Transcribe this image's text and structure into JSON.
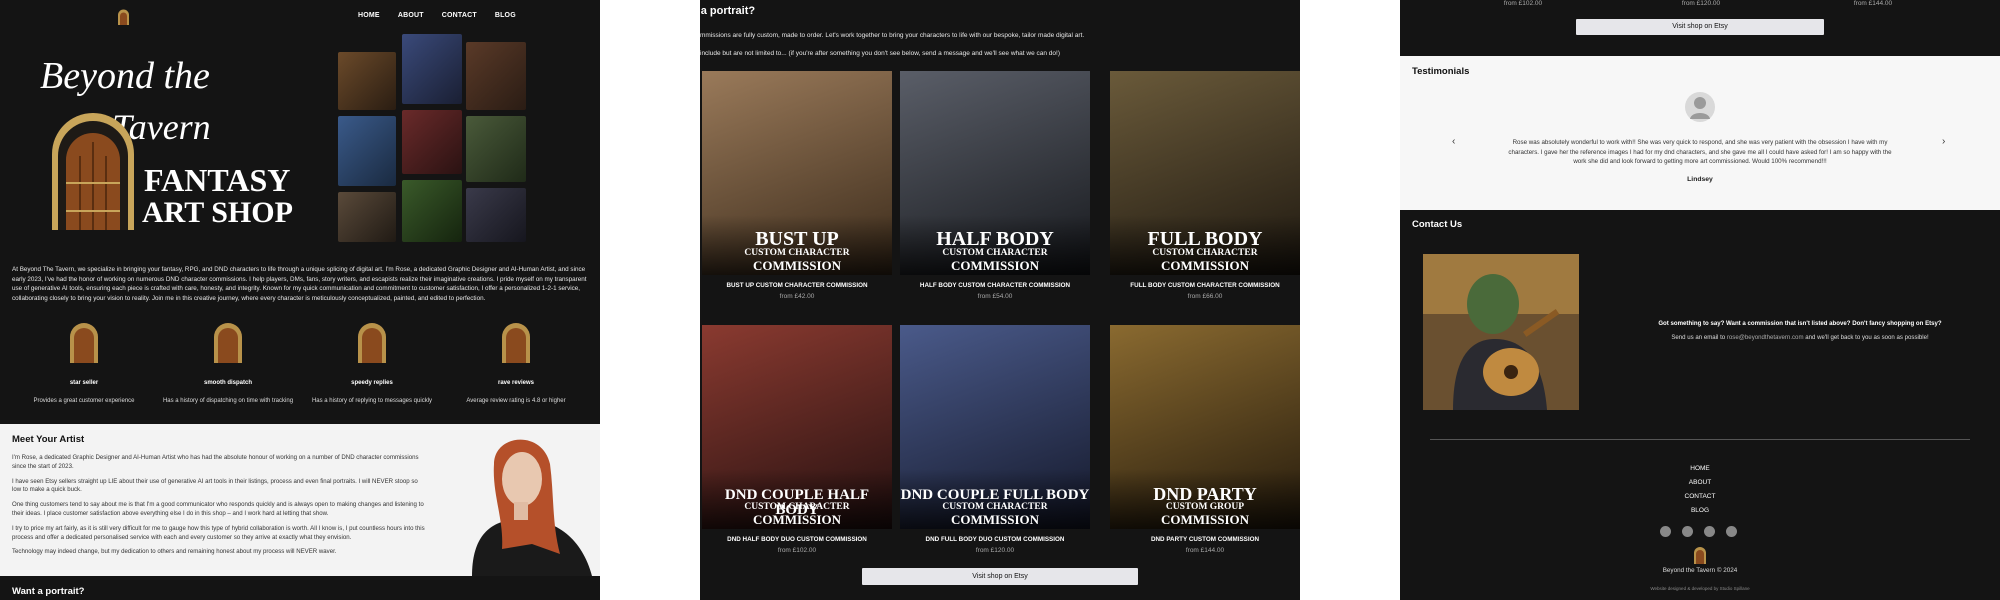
{
  "nav": {
    "links": [
      "HOME",
      "ABOUT",
      "CONTACT",
      "BLOG"
    ]
  },
  "hero": {
    "brand_line1": "Beyond the",
    "brand_line2": "Tavern",
    "brand_line3": "FANTASY",
    "brand_line4": "ART SHOP"
  },
  "intro": "At Beyond The Tavern, we specialize in bringing your fantasy, RPG, and DND characters to life through a unique splicing of digital art. I'm Rose, a dedicated Graphic Designer and AI-Human Artist, and since early 2023, I've had the honor of working on numerous DND character commissions. I help players, DMs, fans, story writers, and escapists realize their imaginative creations. I pride myself on my transparent use of generative AI tools, ensuring each piece is crafted with care, honesty, and integrity. Known for my quick communication and commitment to customer satisfaction, I offer a personalized 1-2-1 service, collaborating closely to bring your vision to reality. Join me in this creative journey, where every character is meticulously conceptualized, painted, and edited to perfection.",
  "features": [
    {
      "title": "star seller",
      "desc": "Provides a great customer experience"
    },
    {
      "title": "smooth dispatch",
      "desc": "Has a history of dispatching on time with tracking"
    },
    {
      "title": "speedy replies",
      "desc": "Has a history of replying to messages quickly"
    },
    {
      "title": "rave reviews",
      "desc": "Average review rating is 4.8 or higher"
    }
  ],
  "meet": {
    "heading": "Meet Your Artist",
    "paragraphs": [
      "I'm Rose, a dedicated Graphic Designer and AI-Human Artist who has had the absolute honour of working on a number of DND character commissions since the start of 2023.",
      "I have seen Etsy sellers straight up LIE about their use of generative AI art tools in their listings, process and even final portraits. I will NEVER stoop so low to make a quick buck.",
      "One thing customers tend to say about me is that I'm a good communicator who responds quickly and is always open to making changes and listening to their ideas. I place customer satisfaction above everything else I do in this shop – and I work hard at letting that show.",
      "I try to price my art fairly, as it is still very difficult for me to gauge how this type of hybrid collaboration is worth. All I know is, I put countless hours into this process and offer a dedicated personalised service with each and every customer so they arrive at exactly what they envision.",
      "Technology may indeed change, but my dedication to others and remaining honest about my process will NEVER waver."
    ]
  },
  "want_heading": "Want a portrait?",
  "portraits": {
    "heading": "t a portrait?",
    "line1": "mmissions are fully custom, made to order. Let's work together to bring your characters to life with our bespoke, tailor made digital art.",
    "line2": "include but are not limited to... (if you're after something you don't see below, send a message and we'll see what we can do!)",
    "cards": [
      {
        "big1": "BUST UP",
        "big2": "CUSTOM CHARACTER",
        "big3": "COMMISSION",
        "caption": "BUST UP CUSTOM CHARACTER COMMISSION",
        "price": "from £42.00",
        "color": "#7a5a3a"
      },
      {
        "big1": "HALF BODY",
        "big2": "CUSTOM CHARACTER",
        "big3": "COMMISSION",
        "caption": "HALF BODY CUSTOM CHARACTER COMMISSION",
        "price": "from £54.00",
        "color": "#3a3d44"
      },
      {
        "big1": "FULL BODY",
        "big2": "CUSTOM CHARACTER",
        "big3": "COMMISSION",
        "caption": "FULL BODY CUSTOM CHARACTER COMMISSION",
        "price": "from £66.00",
        "color": "#4a3a2a"
      },
      {
        "big1": "DND COUPLE HALF BODY",
        "big2": "CUSTOM CHARACTER",
        "big3": "COMMISSION",
        "caption": "DND HALF BODY DUO CUSTOM COMMISSION",
        "price": "from £102.00",
        "color": "#5a2f2a"
      },
      {
        "big1": "DND COUPLE FULL BODY",
        "big2": "CUSTOM CHARACTER",
        "big3": "COMMISSION",
        "caption": "DND FULL BODY DUO CUSTOM COMMISSION",
        "price": "from £120.00",
        "color": "#2f3450"
      },
      {
        "big1": "DND PARTY",
        "big2": "CUSTOM GROUP",
        "big3": "COMMISSION",
        "caption": "DND PARTY CUSTOM COMMISSION",
        "price": "from £144.00",
        "color": "#5a4020"
      }
    ],
    "etsy_button": "Visit shop on Etsy"
  },
  "panel3": {
    "top_prices": [
      "from £102.00",
      "from £120.00",
      "from £144.00"
    ],
    "etsy_button": "Visit shop on Etsy",
    "testimonials_heading": "Testimonials",
    "quote": "Rose was absolutely wonderful to work with!! She was very quick to respond, and she was very patient with the obsession I have with my characters. I gave her the reference images I had for my dnd characters, and she gave me all I could have asked for! I am so happy with the work she did and look forward to getting more art commissioned. Would 100% recommend!!!",
    "author": "Lindsey",
    "contact_heading": "Contact Us",
    "contact_line1": "Got something to say? Want a commission that isn't listed above? Don't fancy shopping on Etsy?",
    "contact_line2a": "Send us an email to ",
    "contact_email": "rose@beyondthetavern.com",
    "contact_line2b": " and we'll get back to you as soon as possible!",
    "footer_links": [
      "HOME",
      "ABOUT",
      "CONTACT",
      "BLOG"
    ],
    "copyright": "Beyond the Tavern © 2024",
    "small_credit": "Website designed & developed by Studio Spillane"
  },
  "colors": {
    "background": "#141414",
    "light_section": "#f3f3f3",
    "gold": "#b8924a",
    "door_wood": "#8a4a1e"
  }
}
